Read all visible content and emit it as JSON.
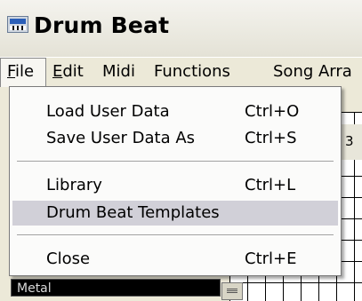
{
  "window": {
    "title": "Drum Beat",
    "icon": "app-icon"
  },
  "menubar": {
    "items": [
      {
        "pre": "",
        "key": "F",
        "post": "ile"
      },
      {
        "pre": "",
        "key": "E",
        "post": "dit"
      },
      {
        "pre": "",
        "key": "",
        "post": "Midi"
      },
      {
        "pre": "",
        "key": "",
        "post": "Functions"
      },
      {
        "pre": "",
        "key": "",
        "post": "Song Arra"
      }
    ]
  },
  "file_menu": {
    "items": [
      {
        "label": "Load User Data",
        "shortcut": "Ctrl+O"
      },
      {
        "label": "Save User Data As",
        "shortcut": "Ctrl+S"
      },
      {
        "label": "Library",
        "shortcut": "Ctrl+L"
      },
      {
        "label": "Drum Beat Templates",
        "shortcut": ""
      },
      {
        "label": "Close",
        "shortcut": "Ctrl+E"
      }
    ],
    "highlighted_index": 3
  },
  "background": {
    "grid_header_number": "3",
    "field_text": "Metal"
  },
  "colors": {
    "highlight": "#d1d0d8",
    "menu_bg": "#fbfbfa",
    "window_bg": "#ece9d8"
  }
}
